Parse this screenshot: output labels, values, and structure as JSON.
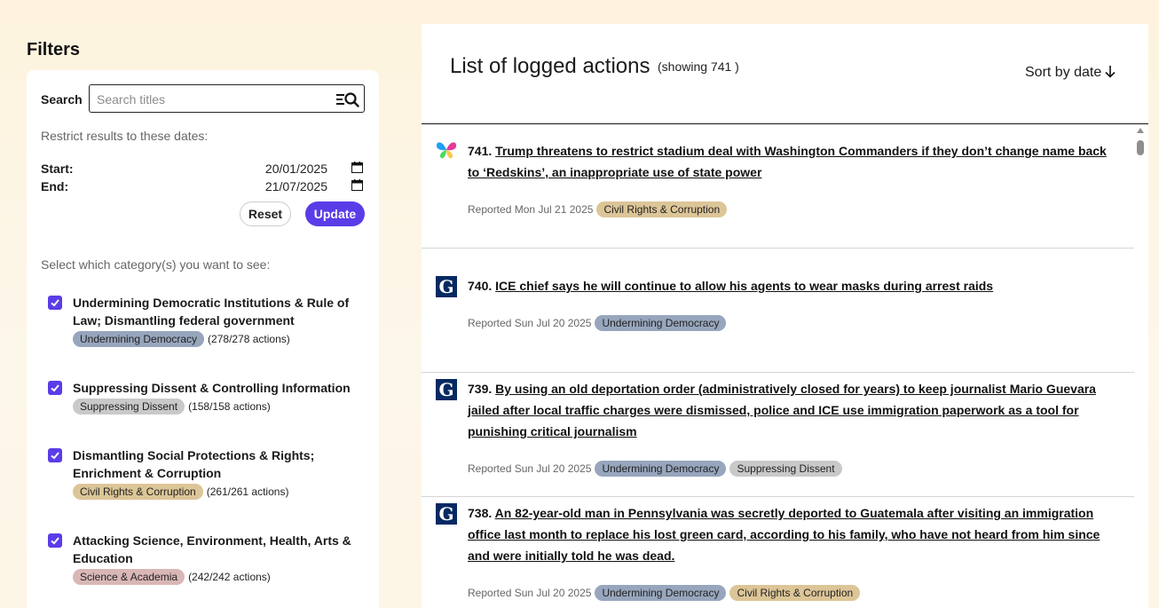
{
  "filters": {
    "title": "Filters",
    "search": {
      "label": "Search",
      "placeholder": "Search titles",
      "value": ""
    },
    "dates_hint": "Restrict results to these dates:",
    "start": {
      "label": "Start:",
      "value": "20/01/2025"
    },
    "end": {
      "label": "End:",
      "value": "21/07/2025"
    },
    "reset_label": "Reset",
    "update_label": "Update",
    "categories_hint": "Select which category(s) you want to see:",
    "categories": [
      {
        "name": "Undermining Democratic Institutions & Rule of Law; Dismantling federal government",
        "tag": "Undermining Democracy",
        "count": "(278/278 actions)",
        "checked": true
      },
      {
        "name": "Suppressing Dissent & Controlling Information",
        "tag": "Suppressing Dissent",
        "count": "(158/158 actions)",
        "checked": true
      },
      {
        "name": "Dismantling Social Protections & Rights; Enrichment & Corruption",
        "tag": "Civil Rights & Corruption",
        "count": "(261/261 actions)",
        "checked": true
      },
      {
        "name": "Attacking Science, Environment, Health, Arts & Education",
        "tag": "Science & Academia",
        "count": "(242/242 actions)",
        "checked": true
      }
    ]
  },
  "list": {
    "title": "List of logged actions",
    "count": "(showing 741 )",
    "sort_label": "Sort by date",
    "entries": [
      {
        "number": "741.",
        "headline": "Trump threatens to restrict stadium deal with Washington Commanders if they don’t change name back to ‘Redskins’, an inappropriate use of state power",
        "reported": "Reported Mon Jul 21 2025",
        "tags": [
          "Civil Rights & Corruption"
        ],
        "source_icon": "butterfly-icon"
      },
      {
        "number": "740.",
        "headline": "ICE chief says he will continue to allow his agents to wear masks during arrest raids",
        "reported": "Reported Sun Jul 20 2025",
        "tags": [
          "Undermining Democracy"
        ],
        "source_icon": "guardian-icon"
      },
      {
        "number": "739.",
        "headline": "By using an old deportation order (administratively closed for years) to keep journalist Mario Guevara jailed after local traffic charges were dismissed, police and ICE use immigration paperwork as a tool for punishing critical journalism",
        "reported": "Reported Sun Jul 20 2025",
        "tags": [
          "Undermining Democracy",
          "Suppressing Dissent"
        ],
        "source_icon": "guardian-icon"
      },
      {
        "number": "738.",
        "headline": "An 82-year-old man in Pennsylvania was secretly deported to Guatemala after visiting an immigration office last month to replace his lost green card, according to his family, who have not heard from him since and were initially told he was dead.",
        "reported": "Reported Sun Jul 20 2025",
        "tags": [
          "Undermining Democracy",
          "Civil Rights & Corruption"
        ],
        "source_icon": "guardian-icon"
      }
    ]
  },
  "colors": {
    "accent": "#5b3ce8",
    "tag_undermining_democracy": "#97a6bd",
    "tag_suppressing_dissent": "#c9c9c9",
    "tag_civil_rights": "#dcc597",
    "tag_science": "#d9b7b7"
  }
}
